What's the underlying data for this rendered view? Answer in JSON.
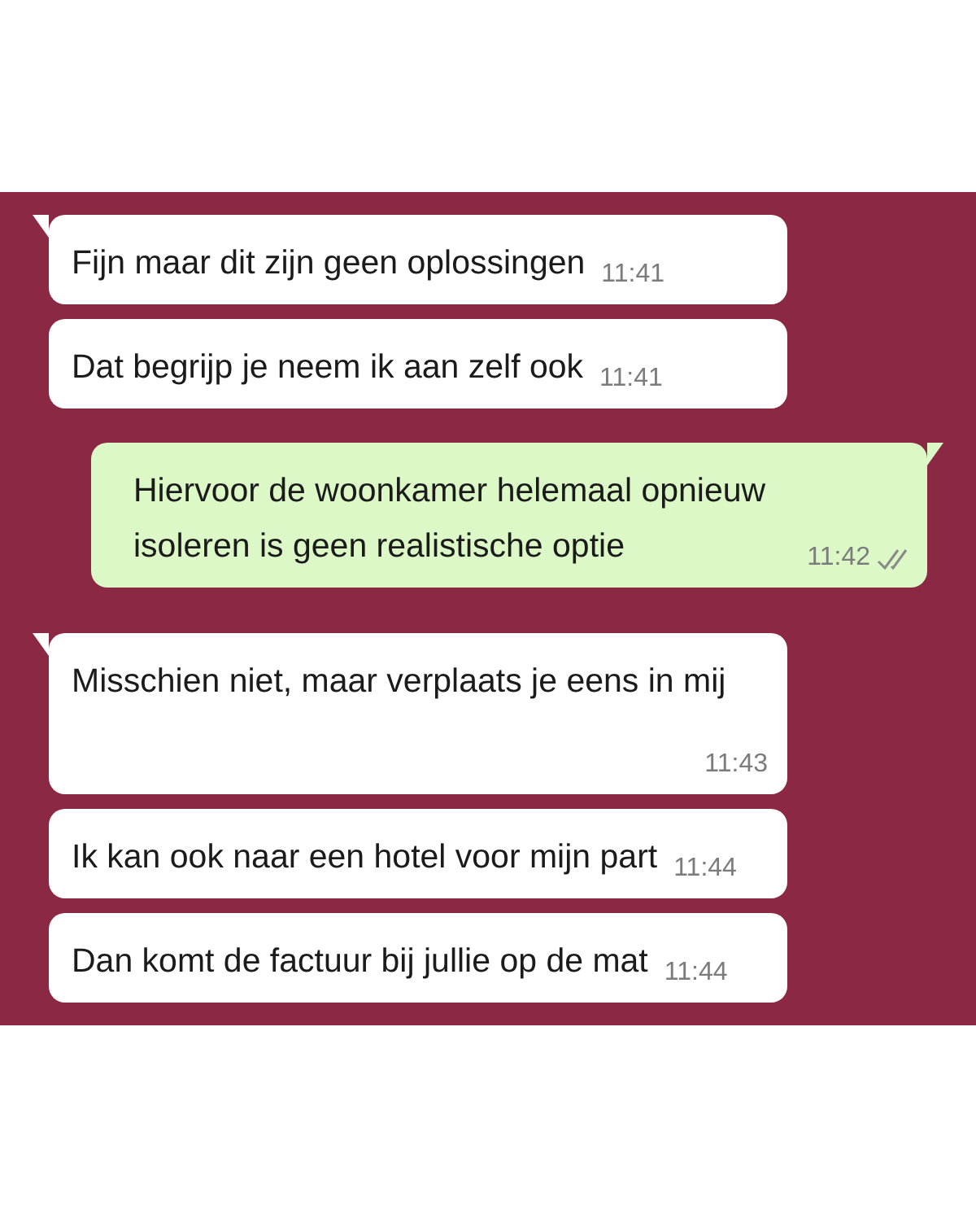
{
  "messages": [
    {
      "kind": "incoming",
      "tail": true,
      "text": "Fijn maar dit zijn geen oplossingen",
      "time": "11:41",
      "time_below": false
    },
    {
      "kind": "incoming",
      "tail": false,
      "text": "Dat begrijp je neem ik aan zelf ook",
      "time": "11:41",
      "time_below": false
    },
    {
      "kind": "outgoing",
      "tail": true,
      "text": "Hiervoor de woonkamer helemaal opnieuw isoleren is geen realistische optie",
      "time": "11:42",
      "time_below": false
    },
    {
      "kind": "incoming",
      "tail": true,
      "text": "Misschien niet, maar verplaats je eens in mij",
      "time": "11:43",
      "time_below": true
    },
    {
      "kind": "incoming",
      "tail": false,
      "text": "Ik kan ook naar een hotel voor mijn part",
      "time": "11:44",
      "time_below": false
    },
    {
      "kind": "incoming",
      "tail": false,
      "text": "Dan komt de factuur bij jullie op de mat",
      "time": "11:44",
      "time_below": false
    }
  ]
}
